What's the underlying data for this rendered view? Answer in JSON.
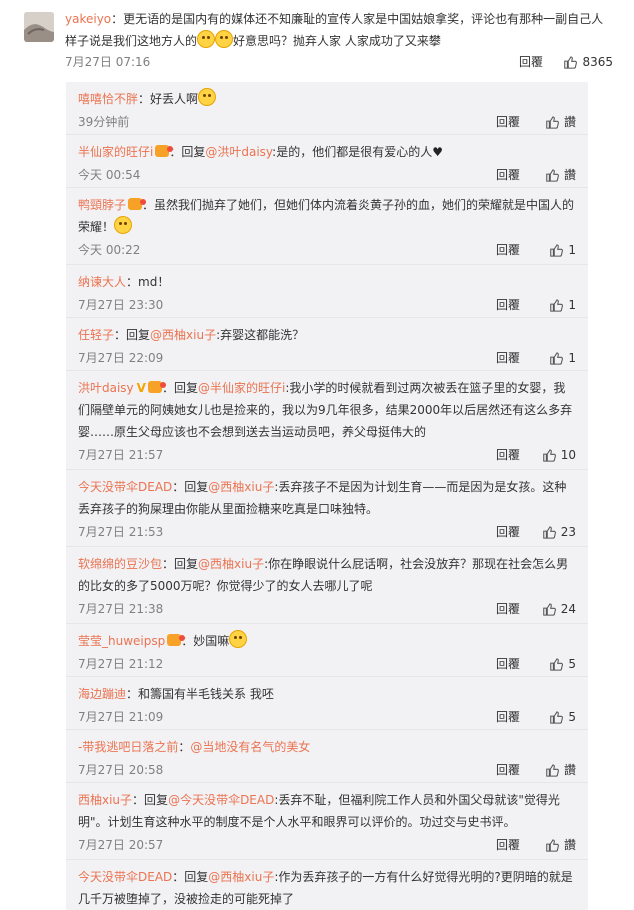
{
  "top_comment": {
    "user": "yakeiyo",
    "text": "更无语的是国内有的媒体还不知廉耻的宣传人家是中国姑娘拿奖，评论也有那种一副自己人样子说是我们这地方人的",
    "text_after_emoji": "好意思吗？抛弃人家 人家成功了又来攀",
    "time": "7月27日 07:16",
    "reply_label": "回覆",
    "like_count": "8365"
  },
  "replies": [
    {
      "user": "嘻嘻恰不胖",
      "text": "：好丢人啊",
      "emoji_after": true,
      "time": "39分钟前",
      "reply_label": "回覆",
      "like_label": "讚"
    },
    {
      "user": "半仙家的旺仔i",
      "badge": true,
      "prefix": "：回复",
      "mention": "@洪叶daisy",
      "text": ":是的，他们都是很有爱心的人",
      "heart": "♥",
      "time": "今天 00:54",
      "reply_label": "回覆",
      "like_label": "讚"
    },
    {
      "user": "鸭頸脖子",
      "badge": true,
      "text": "：虽然我们抛弃了她们，但她们体内流着炎黄子孙的血，她们的荣耀就是中国人的荣耀！",
      "emoji_after": true,
      "time": "今天 00:22",
      "reply_label": "回覆",
      "like_label": "1"
    },
    {
      "user": "纳谏大人",
      "text": "：md！",
      "time": "7月27日 23:30",
      "reply_label": "回覆",
      "like_label": "1"
    },
    {
      "user": "任轻子",
      "prefix": "：回复",
      "mention": "@西柚xiu子",
      "text": ":弃婴这都能洗？",
      "time": "7月27日 22:09",
      "reply_label": "回覆",
      "like_label": "1"
    },
    {
      "user": "洪叶daisy",
      "vip": "V",
      "badge": true,
      "prefix": "：回复",
      "mention": "@半仙家的旺仔i",
      "text": ":我小学的时候就看到过两次被丢在篮子里的女婴，我们隔壁单元的阿姨她女儿也是捡来的，我以为9几年很多，结果2000年以后居然还有这么多弃婴……原生父母应该也不会想到送去当运动员吧，养父母挺伟大的",
      "time": "7月27日 21:57",
      "reply_label": "回覆",
      "like_label": "10"
    },
    {
      "user": "今天没带伞DEAD",
      "prefix": "：回复",
      "mention": "@西柚xiu子",
      "text": ":丢弃孩子不是因为计划生育——而是因为是女孩。这种丢弃孩子的狗屎理由你能从里面捡糖来吃真是口味独特。",
      "time": "7月27日 21:53",
      "reply_label": "回覆",
      "like_label": "23"
    },
    {
      "user": "软绵绵的豆沙包",
      "prefix": "：回复",
      "mention": "@西柚xiu子",
      "text": ":你在睁眼说什么屁话啊，社会没放弃？那现在社会怎么男的比女的多了5000万呢？你觉得少了的女人去哪儿了呢",
      "time": "7月27日 21:38",
      "reply_label": "回覆",
      "like_label": "24"
    },
    {
      "user": "莹莹_huweipsp",
      "badge": true,
      "text": "：妙国嘛",
      "emoji_after": true,
      "time": "7月27日 21:12",
      "reply_label": "回覆",
      "like_label": "5"
    },
    {
      "user": "海边蹦迪",
      "text": "：和籌国有半毛钱关系 我呸",
      "time": "7月27日 21:09",
      "reply_label": "回覆",
      "like_label": "5"
    },
    {
      "user": "-带我逃吧日落之前",
      "prefix": "：",
      "mention": "@当地没有名气的美女",
      "text": "",
      "time": "7月27日 20:58",
      "reply_label": "回覆",
      "like_label": "讚"
    },
    {
      "user": "西柚xiu子",
      "prefix": "：回复",
      "mention": "@今天没带伞DEAD",
      "text": ":丢弃不耻，但福利院工作人员和外国父母就该\"觉得光明\"。计划生育这种水平的制度不是个人水平和眼界可以评价的。功过交与史书评。",
      "time": "7月27日 20:57",
      "reply_label": "回覆",
      "like_label": "讚"
    },
    {
      "user": "今天没带伞DEAD",
      "prefix": "：回复",
      "mention": "@西柚xiu子",
      "text": ":作为丢弃孩子的一方有什么好觉得光明的?更阴暗的就是几千万被堕掉了，没被捡走的可能死掉了",
      "time": "",
      "reply_label": "",
      "like_label": ""
    }
  ],
  "colors": {
    "accent": "#eb7350",
    "meta": "#808080",
    "reply_bg": "#f2f2f5"
  },
  "icons": {
    "like": "thumb-up-icon",
    "emoji": "smiley-icon",
    "badge": "fan-badge-icon",
    "heart": "heart-icon"
  }
}
